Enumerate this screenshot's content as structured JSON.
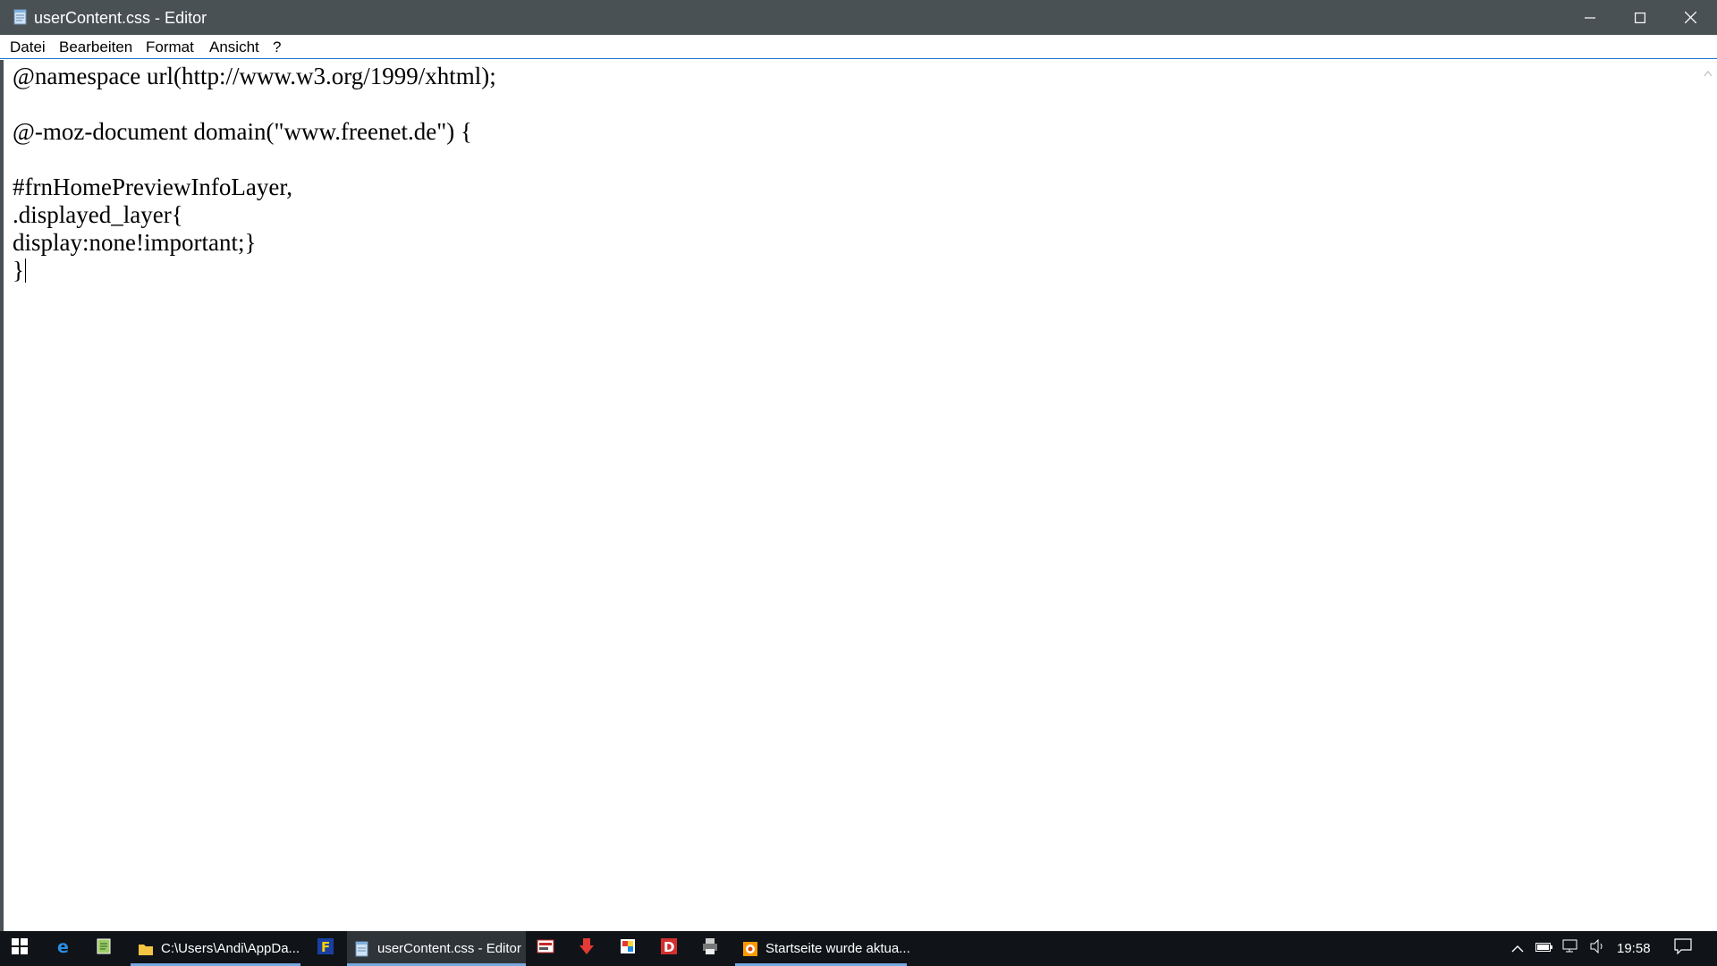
{
  "window": {
    "title": "userContent.css - Editor",
    "icon": "notepad-icon"
  },
  "window_controls": {
    "minimize_icon": "minimize-icon",
    "maximize_icon": "maximize-icon",
    "close_icon": "close-icon"
  },
  "menu": {
    "items": [
      "Datei",
      "Bearbeiten",
      "Format",
      "Ansicht",
      "?"
    ]
  },
  "editor": {
    "lines": [
      "@namespace url(http://www.w3.org/1999/xhtml);",
      "",
      "@-moz-document domain(\"www.freenet.de\") {",
      "",
      "#frnHomePreviewInfoLayer,",
      ".displayed_layer{",
      "display:none!important;}",
      "}"
    ]
  },
  "taskbar": {
    "start_icon": "windows-start-icon",
    "pinned": [
      "edge-icon",
      "notepad-plus-icon"
    ],
    "tasks": [
      {
        "label": "C:\\Users\\Andi\\AppDa...",
        "icon": "folder-icon",
        "active": false,
        "open": true
      },
      {
        "label": "userContent.css - Editor",
        "icon": "notepad-icon",
        "active": true,
        "open": true
      },
      {
        "label": "Startseite wurde aktua...",
        "icon": "browser-icon",
        "active": false,
        "open": true
      }
    ],
    "app_icons": [
      "filezilla-icon",
      "media-app-icon",
      "download-icon",
      "paint-icon",
      "d-app-icon",
      "printer-icon"
    ],
    "tray_icons": [
      "chevron-up-icon",
      "battery-icon",
      "network-icon",
      "volume-icon"
    ],
    "clock": "19:58",
    "notification_icon": "notification-icon"
  },
  "colors": {
    "titlebar": "#4a5155",
    "menu_border": "#1f78d1",
    "taskbar": "#101419",
    "active_task_underline": "#76a8dd"
  }
}
